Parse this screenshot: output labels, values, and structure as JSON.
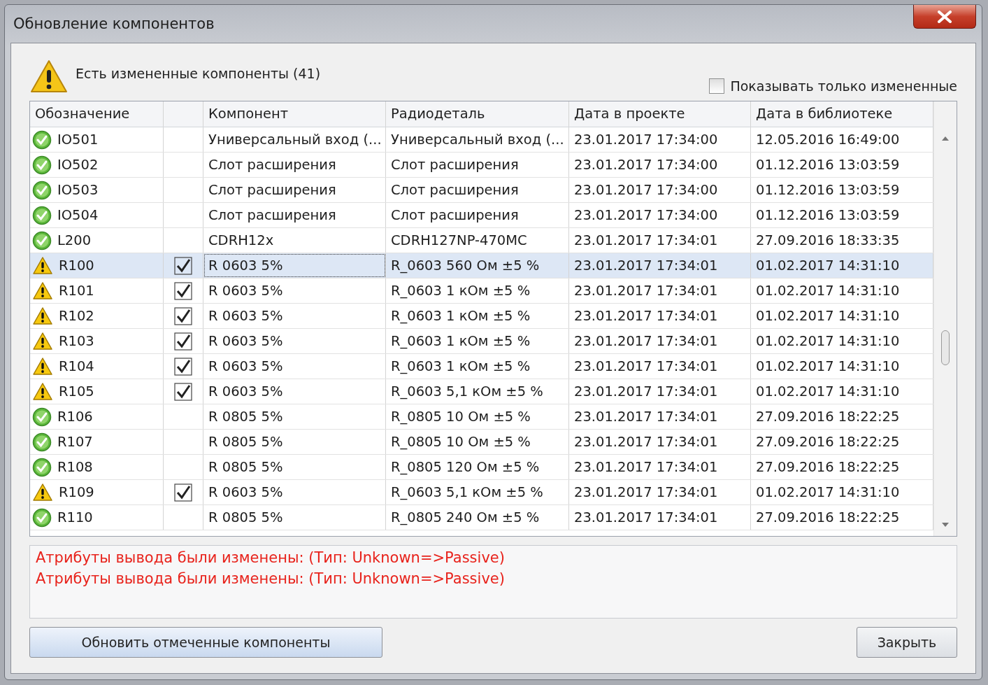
{
  "window": {
    "title": "Обновление компонентов"
  },
  "header": {
    "message": "Есть измененные компоненты (41)",
    "filter": {
      "label": "Показывать только измененные",
      "checked": false
    }
  },
  "table": {
    "columns": [
      "Обозначение",
      "",
      "Компонент",
      "Радиодеталь",
      "Дата в проекте",
      "Дата в библиотеке"
    ],
    "rows": [
      {
        "kind": "ok",
        "designator": "IO501",
        "checked": false,
        "selected": false,
        "component": "Универсальный вход (...",
        "part": "Универсальный вход (...",
        "project_date": "23.01.2017 17:34:00",
        "library_date": "12.05.2016 16:49:00"
      },
      {
        "kind": "ok",
        "designator": "IO502",
        "checked": false,
        "selected": false,
        "component": "Слот расширения",
        "part": "Слот расширения",
        "project_date": "23.01.2017 17:34:00",
        "library_date": "01.12.2016 13:03:59"
      },
      {
        "kind": "ok",
        "designator": "IO503",
        "checked": false,
        "selected": false,
        "component": "Слот расширения",
        "part": "Слот расширения",
        "project_date": "23.01.2017 17:34:00",
        "library_date": "01.12.2016 13:03:59"
      },
      {
        "kind": "ok",
        "designator": "IO504",
        "checked": false,
        "selected": false,
        "component": "Слот расширения",
        "part": "Слот расширения",
        "project_date": "23.01.2017 17:34:00",
        "library_date": "01.12.2016 13:03:59"
      },
      {
        "kind": "ok",
        "designator": "L200",
        "checked": false,
        "selected": false,
        "component": "CDRH12x",
        "part": "CDRH127NP-470MC",
        "project_date": "23.01.2017 17:34:01",
        "library_date": "27.09.2016 18:33:35"
      },
      {
        "kind": "warning",
        "designator": "R100",
        "checked": true,
        "selected": true,
        "component": "R 0603 5%",
        "part": "R_0603 560 Ом ±5 %",
        "project_date": "23.01.2017 17:34:01",
        "library_date": "01.02.2017 14:31:10"
      },
      {
        "kind": "warning",
        "designator": "R101",
        "checked": true,
        "selected": false,
        "component": "R 0603 5%",
        "part": "R_0603 1 кОм ±5 %",
        "project_date": "23.01.2017 17:34:01",
        "library_date": "01.02.2017 14:31:10"
      },
      {
        "kind": "warning",
        "designator": "R102",
        "checked": true,
        "selected": false,
        "component": "R 0603 5%",
        "part": "R_0603 1 кОм ±5 %",
        "project_date": "23.01.2017 17:34:01",
        "library_date": "01.02.2017 14:31:10"
      },
      {
        "kind": "warning",
        "designator": "R103",
        "checked": true,
        "selected": false,
        "component": "R 0603 5%",
        "part": "R_0603 1 кОм ±5 %",
        "project_date": "23.01.2017 17:34:01",
        "library_date": "01.02.2017 14:31:10"
      },
      {
        "kind": "warning",
        "designator": "R104",
        "checked": true,
        "selected": false,
        "component": "R 0603 5%",
        "part": "R_0603 1 кОм ±5 %",
        "project_date": "23.01.2017 17:34:01",
        "library_date": "01.02.2017 14:31:10"
      },
      {
        "kind": "warning",
        "designator": "R105",
        "checked": true,
        "selected": false,
        "component": "R 0603 5%",
        "part": "R_0603 5,1 кОм ±5 %",
        "project_date": "23.01.2017 17:34:01",
        "library_date": "01.02.2017 14:31:10"
      },
      {
        "kind": "ok",
        "designator": "R106",
        "checked": false,
        "selected": false,
        "component": "R 0805 5%",
        "part": "R_0805 10 Ом ±5 %",
        "project_date": "23.01.2017 17:34:01",
        "library_date": "27.09.2016 18:22:25"
      },
      {
        "kind": "ok",
        "designator": "R107",
        "checked": false,
        "selected": false,
        "component": "R 0805 5%",
        "part": "R_0805 10 Ом ±5 %",
        "project_date": "23.01.2017 17:34:01",
        "library_date": "27.09.2016 18:22:25"
      },
      {
        "kind": "ok",
        "designator": "R108",
        "checked": false,
        "selected": false,
        "component": "R 0805 5%",
        "part": "R_0805 120 Ом ±5 %",
        "project_date": "23.01.2017 17:34:01",
        "library_date": "27.09.2016 18:22:25"
      },
      {
        "kind": "warning",
        "designator": "R109",
        "checked": true,
        "selected": false,
        "component": "R 0603 5%",
        "part": "R_0603 5,1 кОм ±5 %",
        "project_date": "23.01.2017 17:34:01",
        "library_date": "01.02.2017 14:31:10"
      },
      {
        "kind": "ok",
        "designator": "R110",
        "checked": false,
        "selected": false,
        "component": "R 0805 5%",
        "part": "R_0805 240 Ом ±5 %",
        "project_date": "23.01.2017 17:34:01",
        "library_date": "27.09.2016 18:22:25"
      }
    ]
  },
  "messages": [
    "Атрибуты вывода были изменены: (Тип: Unknown=>Passive)",
    "Атрибуты вывода были изменены: (Тип: Unknown=>Passive)"
  ],
  "buttons": {
    "update": "Обновить отмеченные компоненты",
    "close": "Закрыть"
  }
}
